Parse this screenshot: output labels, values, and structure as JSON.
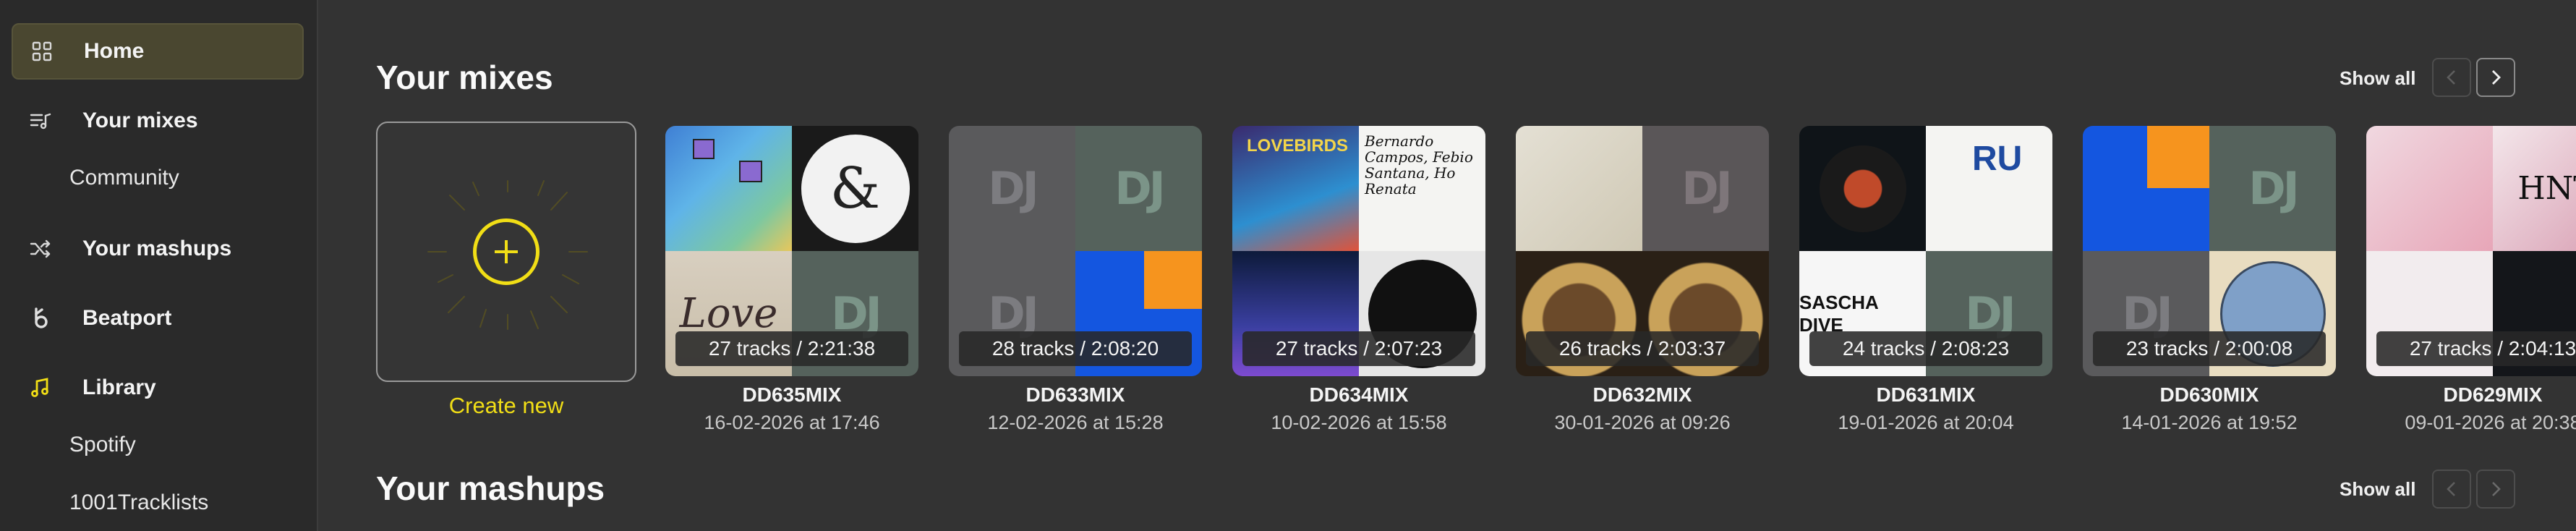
{
  "sidebar": {
    "items": [
      {
        "label": "Home",
        "icon": "grid-icon"
      },
      {
        "label": "Your mixes",
        "icon": "playlist-icon"
      },
      {
        "label": "Community"
      },
      {
        "label": "Your mashups",
        "icon": "shuffle-icon"
      },
      {
        "label": "Beatport",
        "icon": "beatport-icon"
      },
      {
        "label": "Library",
        "icon": "music-note-icon"
      },
      {
        "label": "Spotify"
      },
      {
        "label": "1001Tracklists"
      }
    ]
  },
  "mixes_section": {
    "title": "Your mixes",
    "show_all": "Show all",
    "create_new": "Create new",
    "mixes": [
      {
        "name": "DD635MIX",
        "date": "16-02-2026 at 17:46",
        "info": "27 tracks / 2:21:38"
      },
      {
        "name": "DD633MIX",
        "date": "12-02-2026 at 15:28",
        "info": "28 tracks / 2:08:20"
      },
      {
        "name": "DD634MIX",
        "date": "10-02-2026 at 15:58",
        "info": "27 tracks / 2:07:23"
      },
      {
        "name": "DD632MIX",
        "date": "30-01-2026 at 09:26",
        "info": "26 tracks / 2:03:37"
      },
      {
        "name": "DD631MIX",
        "date": "19-01-2026 at 20:04",
        "info": "24 tracks / 2:08:23"
      },
      {
        "name": "DD630MIX",
        "date": "14-01-2026 at 19:52",
        "info": "23 tracks / 2:00:08"
      },
      {
        "name": "DD629MIX",
        "date": "09-01-2026 at 20:38",
        "info": "27 tracks / 2:04:13"
      }
    ]
  },
  "mashups_section": {
    "title": "Your mashups",
    "show_all": "Show all"
  },
  "artwork_text": {
    "dj": "DJ",
    "lovebirds": "LOVEBIRDS",
    "bernardo": "Bernardo Campos, Febio Santana, Ho Renata",
    "love": "Love",
    "sascha": "SASCHA DIVE",
    "ru": "RU",
    "hn": "HNT",
    "ampersand": "&"
  },
  "colors": {
    "accent": "#f1de16",
    "background": "#333333",
    "sidebar": "#2a2a2a",
    "active_item": "#4a4730"
  }
}
